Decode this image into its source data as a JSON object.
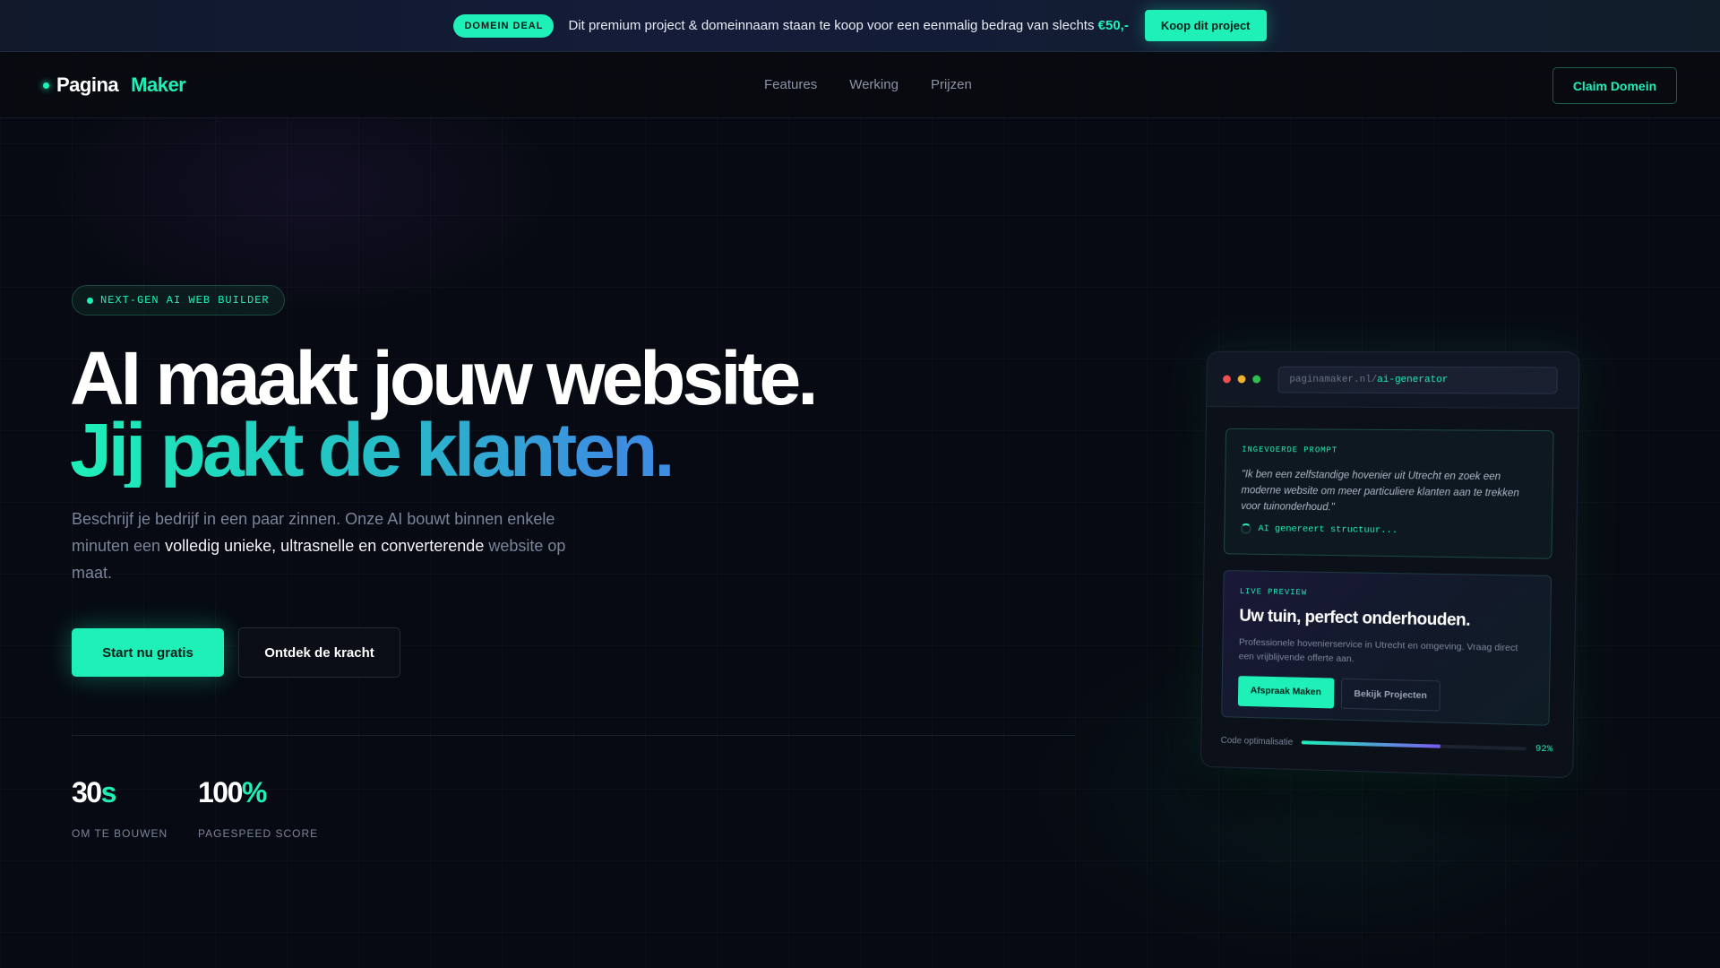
{
  "banner": {
    "badge": "DOMEIN DEAL",
    "text": "Dit premium project & domeinnaam staan te koop voor een eenmalig bedrag van slechts",
    "price": "€50,-",
    "button": "Koop dit project"
  },
  "nav": {
    "logo_part1": "Pagina",
    "logo_part2": "Maker",
    "links": [
      "Features",
      "Werking",
      "Prijzen"
    ],
    "cta": "Claim Domein"
  },
  "hero": {
    "tag": "NEXT-GEN AI WEB BUILDER",
    "headline_line1": "AI maakt jouw website.",
    "headline_line2": "Jij pakt de klanten.",
    "sub_part1": "Beschrijf je bedrijf in een paar zinnen. Onze AI bouwt binnen enkele minuten een",
    "sub_highlight": "volledig unieke, ultrasnelle en converterende",
    "sub_part2": "website op maat.",
    "primary_button": "Start nu gratis",
    "secondary_button": "Ontdek de kracht",
    "stats": [
      {
        "value": "30",
        "unit": "s",
        "label": "OM TE BOUWEN"
      },
      {
        "value": "100",
        "unit": "%",
        "label": "PAGESPEED SCORE"
      }
    ]
  },
  "mockup": {
    "url_prefix": "paginamaker.nl/",
    "url_path": "ai-generator",
    "prompt_label": "INGEVOERDE PROMPT",
    "prompt_text": "\"Ik ben een zelfstandige hovenier uit Utrecht en zoek een moderne website om meer particuliere klanten aan te trekken voor tuinonderhoud.\"",
    "generating": "AI genereert structuur...",
    "preview_label": "LIVE PREVIEW",
    "preview_title": "Uw tuin, perfect onderhouden.",
    "preview_desc": "Professionele hovenierservice in Utrecht en omgeving. Vraag direct een vrijblijvende offerte aan.",
    "preview_btn1": "Afspraak Maken",
    "preview_btn2": "Bekijk Projecten",
    "progress_label": "Code optimalisatie",
    "progress_value": "92%",
    "progress_fill": 0.62
  },
  "colors": {
    "accent": "#1ef0b8",
    "background": "#070a12",
    "gradient_end": "#3d8ee0"
  }
}
